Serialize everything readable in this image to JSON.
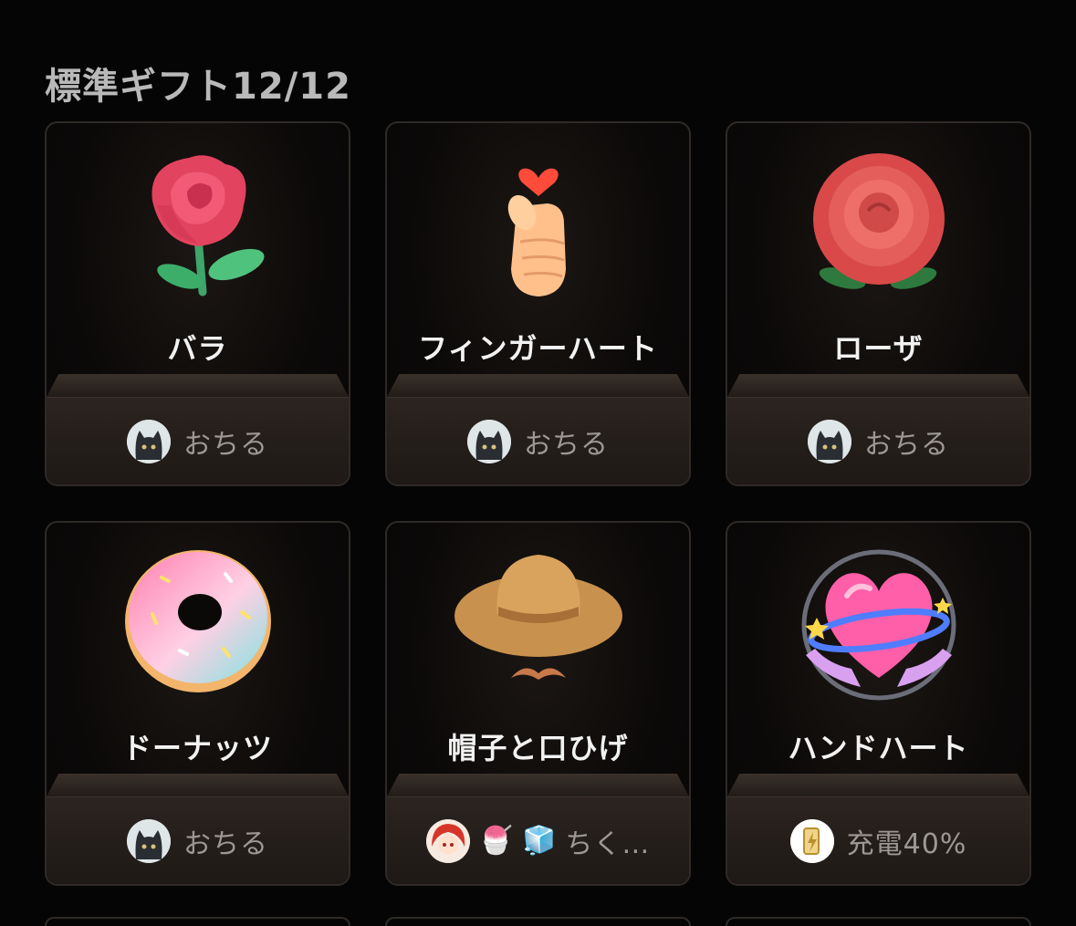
{
  "section": {
    "title": "標準ギフト12/12"
  },
  "gifts": [
    {
      "name": "バラ",
      "icon": "rose-icon",
      "sender": {
        "name": "おちる",
        "avatar": "cat-avatar"
      }
    },
    {
      "name": "フィンガーハート",
      "icon": "finger-heart-icon",
      "sender": {
        "name": "おちる",
        "avatar": "cat-avatar"
      }
    },
    {
      "name": "ローザ",
      "icon": "rosa-icon",
      "sender": {
        "name": "おちる",
        "avatar": "cat-avatar"
      }
    },
    {
      "name": "ドーナッツ",
      "icon": "donut-icon",
      "sender": {
        "name": "おちる",
        "avatar": "cat-avatar"
      }
    },
    {
      "name": "帽子と口ひげ",
      "icon": "hat-mustache-icon",
      "sender": {
        "name": "ちく…",
        "avatar": "anime-avatar",
        "emojis": [
          "🍧",
          "🧊"
        ]
      }
    },
    {
      "name": "ハンドハート",
      "icon": "hand-heart-icon",
      "sender": {
        "name": "充電40%",
        "avatar": "battery-avatar"
      }
    }
  ]
}
